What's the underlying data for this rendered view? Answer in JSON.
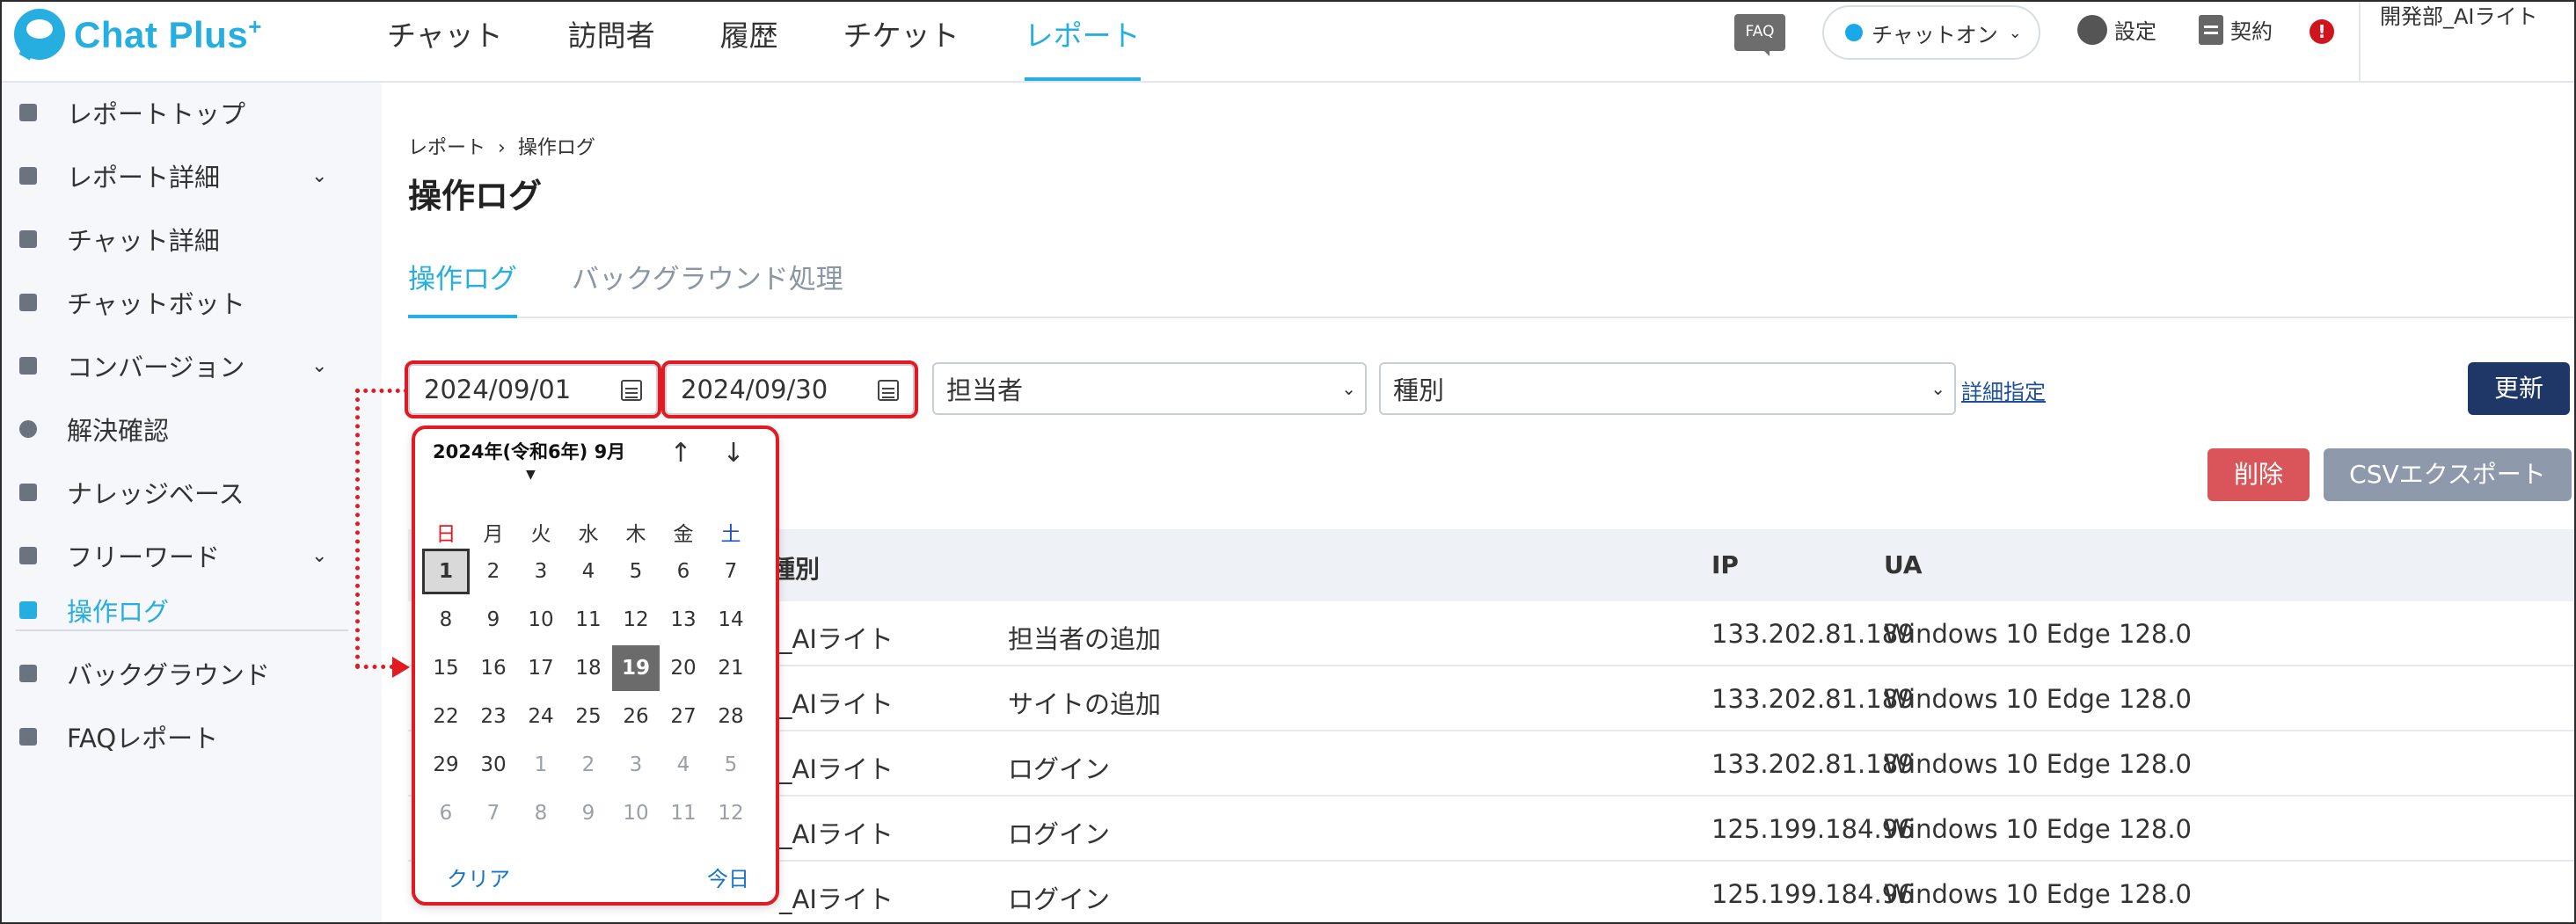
{
  "brand": {
    "name": "Chat Plus",
    "plus": "+"
  },
  "nav": {
    "tabs": [
      "チャット",
      "訪問者",
      "履歴",
      "チケット",
      "レポート"
    ],
    "active_index": 4
  },
  "topbar": {
    "faq": "FAQ",
    "status": "チャットオン",
    "settings": "設定",
    "contract": "契約",
    "alert": "!",
    "user": "開発部_AIライト"
  },
  "sidebar": {
    "items": [
      {
        "label": "レポートトップ",
        "expandable": false
      },
      {
        "label": "レポート詳細",
        "expandable": true
      },
      {
        "label": "チャット詳細",
        "expandable": false
      },
      {
        "label": "チャットボット",
        "expandable": false
      },
      {
        "label": "コンバージョン",
        "expandable": true
      },
      {
        "label": "解決確認",
        "expandable": false
      },
      {
        "label": "ナレッジベース",
        "expandable": false
      },
      {
        "label": "フリーワード",
        "expandable": true
      }
    ],
    "items2": [
      {
        "label": "操作ログ",
        "active": true
      },
      {
        "label": "バックグラウンド",
        "active": false
      },
      {
        "label": "FAQレポート",
        "active": false
      }
    ]
  },
  "breadcrumb": {
    "parent": "レポート",
    "sep": "›",
    "current": "操作ログ"
  },
  "page_title": "操作ログ",
  "subtabs": {
    "active": "操作ログ",
    "other": "バックグラウンド処理"
  },
  "filters": {
    "date_from": "2024/09/01",
    "date_to": "2024/09/30",
    "assignee": "担当者",
    "kind": "種別",
    "detail_link": "詳細指定",
    "update_button": "更新"
  },
  "actions": {
    "delete": "削除",
    "csv": "CSVエクスポート"
  },
  "table": {
    "headers": {
      "kind": "種別",
      "ip": "IP",
      "ua": "UA"
    },
    "rows": [
      {
        "who": "_AIライト",
        "kind": "担当者の追加",
        "ip": "133.202.81.189",
        "ua": "Windows 10 Edge 128.0"
      },
      {
        "who": "_AIライト",
        "kind": "サイトの追加",
        "ip": "133.202.81.189",
        "ua": "Windows 10 Edge 128.0"
      },
      {
        "who": "_AIライト",
        "kind": "ログイン",
        "ip": "133.202.81.189",
        "ua": "Windows 10 Edge 128.0"
      },
      {
        "who": "_AIライト",
        "kind": "ログイン",
        "ip": "125.199.184.96",
        "ua": "Windows 10 Edge 128.0"
      },
      {
        "who": "_AIライト",
        "kind": "ログイン",
        "ip": "125.199.184.96",
        "ua": "Windows 10 Edge 128.0"
      }
    ]
  },
  "calendar": {
    "title": "2024年(令和6年) 9月",
    "up": "↑",
    "down": "↓",
    "weekdays": [
      "日",
      "月",
      "火",
      "水",
      "木",
      "金",
      "土"
    ],
    "weeks": [
      [
        "1",
        "2",
        "3",
        "4",
        "5",
        "6",
        "7"
      ],
      [
        "8",
        "9",
        "10",
        "11",
        "12",
        "13",
        "14"
      ],
      [
        "15",
        "16",
        "17",
        "18",
        "19",
        "20",
        "21"
      ],
      [
        "22",
        "23",
        "24",
        "25",
        "26",
        "27",
        "28"
      ],
      [
        "29",
        "30",
        "1",
        "2",
        "3",
        "4",
        "5"
      ],
      [
        "6",
        "7",
        "8",
        "9",
        "10",
        "11",
        "12"
      ]
    ],
    "selected": "1",
    "today": "19",
    "clear": "クリア",
    "today_label": "今日"
  },
  "colors": {
    "accent": "#27aee0",
    "highlight": "#e21a22",
    "update": "#1e3766",
    "delete": "#d9555a",
    "csv": "#8e99ac"
  }
}
